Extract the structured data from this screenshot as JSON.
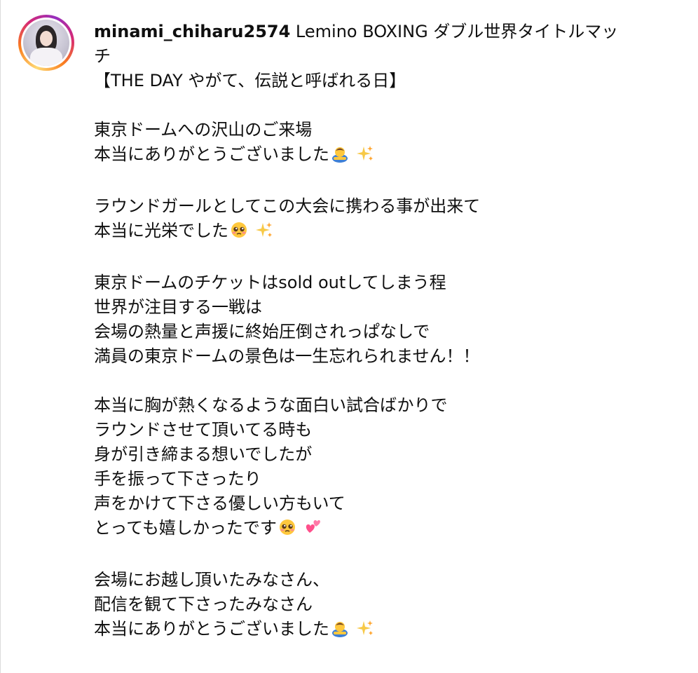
{
  "post": {
    "username": "minami_chiharu2574",
    "caption_lines": [
      " Lemino BOXING ダブル世界タイトルマッ",
      "チ",
      "【THE DAY やがて、伝説と呼ばれる日】",
      "",
      "東京ドームへの沢山のご来場",
      "本当にありがとうございました",
      "",
      "ラウンドガールとしてこの大会に携わる事が出来て",
      "本当に光栄でした",
      "",
      "東京ドームのチケットはsold outしてしまう程",
      "世界が注目する一戦は",
      "会場の熱量と声援に終始圧倒されっぱなしで",
      "満員の東京ドームの景色は一生忘れられません！！",
      "",
      "本当に胸が熱くなるような面白い試合ばかりで",
      "ラウンドさせて頂いてる時も",
      "身が引き締まる想いでしたが",
      "手を振って下さったり",
      "声をかけて下さる優しい方もいて",
      "とっても嬉しかったです",
      "",
      "会場にお越し頂いたみなさん、",
      "配信を観て下さったみなさん",
      "本当にありがとうございました"
    ]
  },
  "icons": {
    "avatar": "profile-photo-with-story-ring",
    "bow": "person-bowing-emoji",
    "sparkles": "sparkles-emoji",
    "pleading": "pleading-face-emoji",
    "hearts": "two-hearts-emoji"
  },
  "colors": {
    "text": "#0f0f0f",
    "ring_start": "#feda75",
    "ring_mid": "#d62976",
    "ring_end": "#962fbf",
    "sparkle": "#f7c948",
    "heart": "#ff4f8b"
  }
}
